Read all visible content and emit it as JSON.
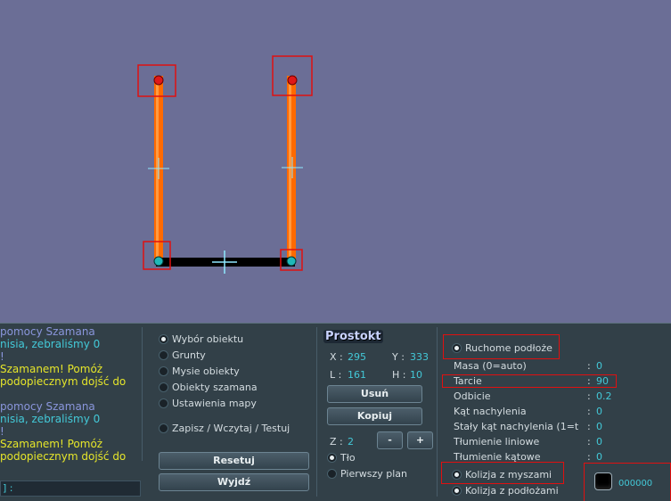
{
  "chat": {
    "lines": [
      {
        "text": "pomocy Szamana",
        "color": "#8a96dc"
      },
      {
        "text": "nisia, zebraliśmy 0",
        "color": "#43c9d8"
      },
      {
        "text": "!",
        "color": "#8a96dc"
      },
      {
        "text": "Szamanem! Pomóż",
        "color": "#e5e52a"
      },
      {
        "text": "podopiecznym dojść do",
        "color": "#e5e52a"
      },
      {
        "text": "",
        "color": "#e5e52a"
      },
      {
        "text": "pomocy Szamana",
        "color": "#8a96dc"
      },
      {
        "text": "nisia, zebraliśmy 0",
        "color": "#43c9d8"
      },
      {
        "text": "!",
        "color": "#8a96dc"
      },
      {
        "text": "Szamanem! Pomóż",
        "color": "#e5e52a"
      },
      {
        "text": "podopiecznym dojść do",
        "color": "#e5e52a"
      }
    ],
    "input_prefix": "] :"
  },
  "menu": {
    "options": [
      "Wybór obiektu",
      "Grunty",
      "Mysie obiekty",
      "Obiekty szamana",
      "Ustawienia mapy"
    ],
    "selected": "Wybór obiektu",
    "save_option": "Zapisz / Wczytaj / Testuj",
    "reset_label": "Resetuj",
    "exit_label": "Wyjdź"
  },
  "object": {
    "title": "Prostokt",
    "x_label": "X :",
    "x_value": "295",
    "y_label": "Y :",
    "y_value": "333",
    "l_label": "L :",
    "l_value": "161",
    "h_label": "H :",
    "h_value": "10",
    "delete_label": "Usuń",
    "copy_label": "Kopiuj",
    "z_label": "Z :",
    "z_value": "2",
    "minus_label": "-",
    "plus_label": "+",
    "layer_bg": "Tło",
    "layer_fg": "Pierwszy plan"
  },
  "properties": {
    "moving_ground": "Ruchome podłoże",
    "rows": [
      {
        "label": "Masa (0=auto)",
        "value": "0"
      },
      {
        "label": "Tarcie",
        "value": "90"
      },
      {
        "label": "Odbicie",
        "value": "0.2"
      },
      {
        "label": "Kąt nachylenia",
        "value": "0"
      },
      {
        "label": "Stały kąt nachylenia (1=t",
        "value": "0"
      },
      {
        "label": "Tłumienie liniowe",
        "value": "0"
      },
      {
        "label": "Tłumienie kątowe",
        "value": "0"
      }
    ],
    "mouse_collision": "Kolizja z myszami",
    "ground_collision": "Kolizja z podłożami",
    "color_hex": "000000"
  },
  "colors": {
    "plank": "#ff6a00",
    "anchor_top": "#e01818",
    "anchor_bottom": "#20b8b8",
    "highlight": "#e01010"
  }
}
